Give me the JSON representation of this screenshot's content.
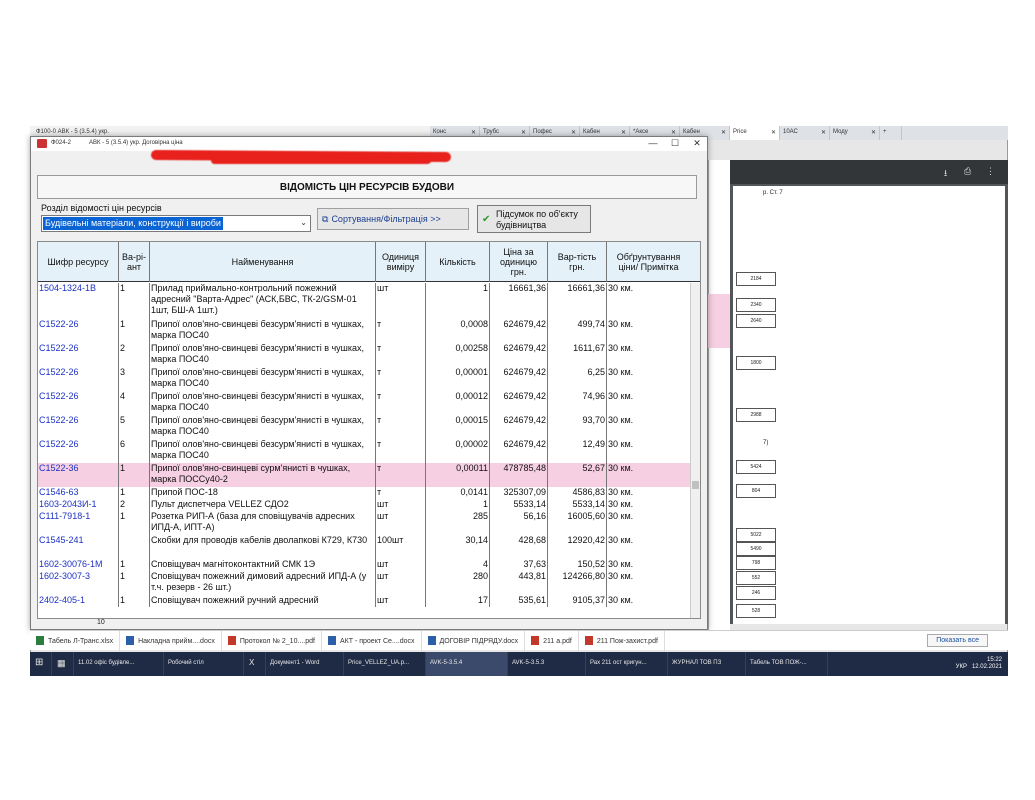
{
  "back_window": {
    "title": "Ф100-0      АВК - 5 (3.5.4) укр."
  },
  "chrome": {
    "tabs": [
      "Конс",
      "Трубс",
      "Пофес",
      "Кабен",
      "*Аксе",
      "Кабен",
      "Price",
      "10АС",
      "Моду"
    ],
    "new_tab": "+",
    "pdf_boxes": [
      "2184",
      "2340",
      "2640",
      "1800",
      "2988",
      "5424",
      "804",
      "5022",
      "5490",
      "798",
      "552",
      "246",
      "528"
    ],
    "pdf_text_1": "р. Ст. 7",
    "pdf_text_2": "7)"
  },
  "window": {
    "form_code": "Ф024-2",
    "app_title": "АВК - 5 (3.5.4) укр. Договірна ціна",
    "minimize": "—",
    "maximize": "☐",
    "close": "✕"
  },
  "report": {
    "title": "ВІДОМІСТЬ ЦІН РЕСУРСІВ БУДОВИ",
    "section_label": "Розділ відомості цін ресурсів",
    "section_value": "Будівельні матеріали, конструкції і вироби",
    "sort_button": "Сортування/Фільтрація >>",
    "summary_button_line1": "Підсумок по об'єкту",
    "summary_button_line2": "будівництва"
  },
  "table": {
    "headers": {
      "code": "Шифр ресурсу",
      "variant": "Ва-рі-ант",
      "name": "Найменування",
      "unit": "Одиниця виміру",
      "qty": "Кількість",
      "price": "Ціна за одиницю грн.",
      "cost": "Вар-тість грн.",
      "note": "Обґрунтування ціни/ Примітка"
    },
    "rows": [
      {
        "code": "1504-1324-1В",
        "variant": "1",
        "name": "Прилад приймально-контрольний пожежний адресний \"Варта-Адрес\" (АСК,БВС, ТК-2/GSM-01 1шт, БШ-А 1шт.)",
        "unit": "шт",
        "qty": "1",
        "price": "16661,36",
        "cost": "16661,36",
        "note": "30 км."
      },
      {
        "code": "С1522-26",
        "variant": "1",
        "name": "Припої олов'яно-свинцеві безсурм'янисті в чушках, марка ПОС40",
        "unit": "т",
        "qty": "0,0008",
        "price": "624679,42",
        "cost": "499,74",
        "note": "30 км."
      },
      {
        "code": "С1522-26",
        "variant": "2",
        "name": "Припої олов'яно-свинцеві безсурм'янисті в чушках, марка ПОС40",
        "unit": "т",
        "qty": "0,00258",
        "price": "624679,42",
        "cost": "1611,67",
        "note": "30 км."
      },
      {
        "code": "С1522-26",
        "variant": "3",
        "name": "Припої олов'яно-свинцеві безсурм'янисті в чушках, марка ПОС40",
        "unit": "т",
        "qty": "0,00001",
        "price": "624679,42",
        "cost": "6,25",
        "note": "30 км."
      },
      {
        "code": "С1522-26",
        "variant": "4",
        "name": "Припої олов'яно-свинцеві безсурм'янисті в чушках, марка ПОС40",
        "unit": "т",
        "qty": "0,00012",
        "price": "624679,42",
        "cost": "74,96",
        "note": "30 км."
      },
      {
        "code": "С1522-26",
        "variant": "5",
        "name": "Припої олов'яно-свинцеві безсурм'янисті в чушках, марка ПОС40",
        "unit": "т",
        "qty": "0,00015",
        "price": "624679,42",
        "cost": "93,70",
        "note": "30 км."
      },
      {
        "code": "С1522-26",
        "variant": "6",
        "name": "Припої олов'яно-свинцеві безсурм'янисті в чушках, марка ПОС40",
        "unit": "т",
        "qty": "0,00002",
        "price": "624679,42",
        "cost": "12,49",
        "note": "30 км."
      },
      {
        "code": "С1522-36",
        "variant": "1",
        "name": "Припої олов'яно-свинцеві сурм'янисті в чушках, марка ПОССу40-2",
        "unit": "т",
        "qty": "0,00011",
        "price": "478785,48",
        "cost": "52,67",
        "note": "30 км."
      },
      {
        "code": "С1546-63",
        "variant": "1",
        "name": "Припой ПОС-18",
        "unit": "т",
        "qty": "0,0141",
        "price": "325307,09",
        "cost": "4586,83",
        "note": "30 км."
      },
      {
        "code": "1603-2043И-1",
        "variant": "2",
        "name": "Пульт диспетчера VELLEZ СДО2",
        "unit": "шт",
        "qty": "1",
        "price": "5533,14",
        "cost": "5533,14",
        "note": "30 км."
      },
      {
        "code": "С111-7918-1",
        "variant": "1",
        "name": "Розетка РИП-А (база для сповіщувачів адресних ИПД-А, ИПТ-А)",
        "unit": "шт",
        "qty": "285",
        "price": "56,16",
        "cost": "16005,60",
        "note": "30 км."
      },
      {
        "code": "С1545-241",
        "variant": "",
        "name": "Скобки для проводів кабелів дволапкові К729, К730",
        "unit": "100шт",
        "qty": "30,14",
        "price": "428,68",
        "cost": "12920,42",
        "note": "30 км."
      },
      {
        "code": "1602-30076-1М",
        "variant": "1",
        "name": "Сповіщувач магнітоконтактний СМК 1Э",
        "unit": "шт",
        "qty": "4",
        "price": "37,63",
        "cost": "150,52",
        "note": "30 км."
      },
      {
        "code": "1602-3007-3",
        "variant": "1",
        "name": "Сповіщувач пожежний димовий адресний ИПД-А (у т.ч. резерв - 26 шт.)",
        "unit": "шт",
        "qty": "280",
        "price": "443,81",
        "cost": "124266,80",
        "note": "30 км."
      },
      {
        "code": "2402-405-1",
        "variant": "1",
        "name": "Сповіщувач пожежний ручний адресний",
        "unit": "шт",
        "qty": "17",
        "price": "535,61",
        "cost": "9105,37",
        "note": "30 км."
      }
    ]
  },
  "status": {
    "number": "10"
  },
  "docs_bar": {
    "items": [
      "Табель Л-Транс.xlsx",
      "Накладна прийм....docx",
      "Протокол № 2_10....pdf",
      "АКТ - проект Се....docx",
      "ДОГОВІР ПІДРЯДУ.docx",
      "211 а.pdf",
      "211 Пож-захист.pdf"
    ],
    "show_all": "Показать все"
  },
  "taskbar": {
    "items": [
      "11.02 офіс будівле...",
      "Робочий стіл",
      "Документ1 - Word",
      "Price_VELLEZ_UA.p...",
      "AVK-5-3.5.4",
      "AVK-5-3.5.3",
      "Рах 211 ост кригун...",
      "ЖУРНАЛ ТОВ ПЗ",
      "Табель ТОВ ПОЖ-..."
    ],
    "lang": "УКР",
    "time": "15:22",
    "date": "12.02.2021"
  }
}
